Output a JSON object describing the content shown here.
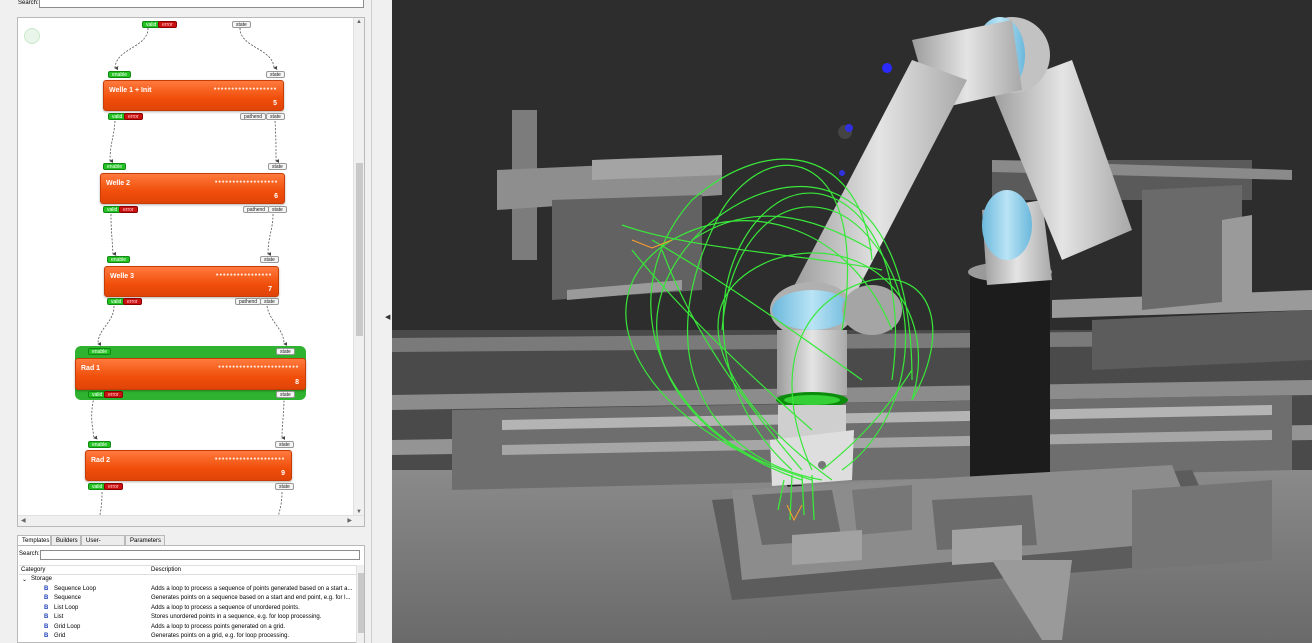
{
  "top_search": {
    "label": "Search:",
    "value": ""
  },
  "nodes": [
    {
      "title": "Welle 1 + Init",
      "number": "5"
    },
    {
      "title": "Welle 2",
      "number": "6"
    },
    {
      "title": "Welle 3",
      "number": "7"
    },
    {
      "title": "Rad 1",
      "number": "8"
    },
    {
      "title": "Rad 2",
      "number": "9"
    }
  ],
  "ports": {
    "enable": "enable",
    "state": "state",
    "valid": "valid",
    "error": "error",
    "pathend": "pathend"
  },
  "tabs": [
    "Templates",
    "Builders",
    "User-defined",
    "Parameters"
  ],
  "templates_panel": {
    "search_label": "Search:",
    "search_value": "",
    "columns": [
      "Category",
      "Description"
    ],
    "rows": [
      {
        "name": "Storage",
        "description": "",
        "group": true
      },
      {
        "name": "Sequence Loop",
        "description": "Adds a loop to process a sequence of points generated based on a start a..."
      },
      {
        "name": "Sequence",
        "description": "Generates points on a sequence based on a start and end point, e.g. for l..."
      },
      {
        "name": "List Loop",
        "description": "Adds a loop to process a sequence of unordered points."
      },
      {
        "name": "List",
        "description": "Stores unordered points in a sequence, e.g. for loop processing."
      },
      {
        "name": "Grid Loop",
        "description": "Adds a loop to process points generated on a grid."
      },
      {
        "name": "Grid",
        "description": "Generates points on a grid, e.g. for loop processing."
      }
    ]
  },
  "icons": {
    "template_item": "b-icon",
    "expand": "chevron-down-icon"
  },
  "colors": {
    "node_orange": "#f04e0a",
    "active_green": "#2fb22f",
    "enable_green": "#22c222",
    "error_red": "#cc1111",
    "viewport_bg": "#2d2d2d",
    "path_green": "#39e83a",
    "robot_blue": "#7ec7e8"
  },
  "scene_labels": {
    "dots": "•••"
  }
}
